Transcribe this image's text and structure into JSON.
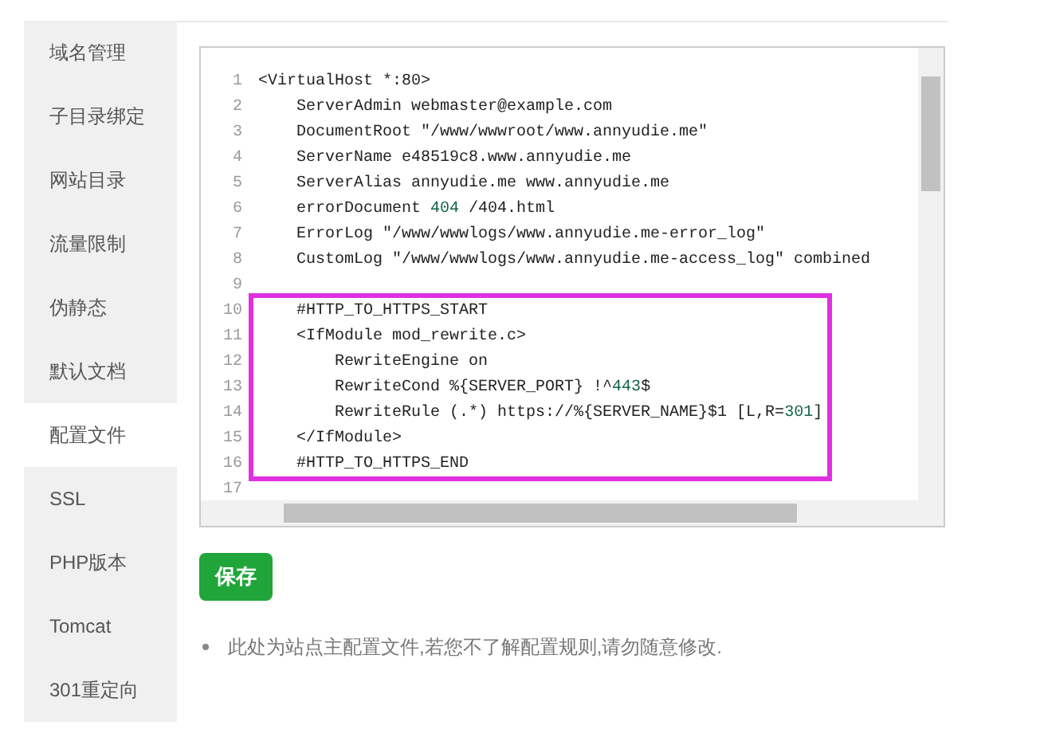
{
  "sidebar": {
    "items": [
      {
        "label": "域名管理",
        "selected": false
      },
      {
        "label": "子目录绑定",
        "selected": false
      },
      {
        "label": "网站目录",
        "selected": false
      },
      {
        "label": "流量限制",
        "selected": false
      },
      {
        "label": "伪静态",
        "selected": false
      },
      {
        "label": "默认文档",
        "selected": false
      },
      {
        "label": "配置文件",
        "selected": true
      },
      {
        "label": "SSL",
        "selected": false
      },
      {
        "label": "PHP版本",
        "selected": false
      },
      {
        "label": "Tomcat",
        "selected": false
      },
      {
        "label": "301重定向",
        "selected": false
      }
    ]
  },
  "editor": {
    "blocks": [
      {
        "highlighted": false,
        "lines": [
          {
            "number": "1",
            "tokens": [
              {
                "text": "<VirtualHost *:80>",
                "kind": "plain"
              }
            ]
          },
          {
            "number": "2",
            "tokens": [
              {
                "text": "    ServerAdmin webmaster@example.com",
                "kind": "plain"
              }
            ]
          },
          {
            "number": "3",
            "tokens": [
              {
                "text": "    DocumentRoot \"/www/wwwroot/www.annyudie.me\"",
                "kind": "plain"
              }
            ]
          },
          {
            "number": "4",
            "tokens": [
              {
                "text": "    ServerName e48519c8.www.annyudie.me",
                "kind": "plain"
              }
            ]
          },
          {
            "number": "5",
            "tokens": [
              {
                "text": "    ServerAlias annyudie.me www.annyudie.me",
                "kind": "plain"
              }
            ]
          },
          {
            "number": "6",
            "tokens": [
              {
                "text": "    errorDocument ",
                "kind": "plain"
              },
              {
                "text": "404",
                "kind": "number"
              },
              {
                "text": " /404.html",
                "kind": "plain"
              }
            ]
          },
          {
            "number": "7",
            "tokens": [
              {
                "text": "    ErrorLog \"/www/wwwlogs/www.annyudie.me-error_log\"",
                "kind": "plain"
              }
            ]
          },
          {
            "number": "8",
            "tokens": [
              {
                "text": "    CustomLog \"/www/wwwlogs/www.annyudie.me-access_log\" combined",
                "kind": "plain"
              }
            ]
          },
          {
            "number": "9"
          }
        ]
      },
      {
        "highlighted": true,
        "lines": [
          {
            "number": "10",
            "tokens": [
              {
                "text": "    #HTTP_TO_HTTPS_START",
                "kind": "plain"
              }
            ]
          },
          {
            "number": "11",
            "tokens": [
              {
                "text": "    <IfModule mod_rewrite.c>",
                "kind": "plain"
              }
            ]
          },
          {
            "number": "12",
            "tokens": [
              {
                "text": "        RewriteEngine on",
                "kind": "plain"
              }
            ]
          },
          {
            "number": "13",
            "tokens": [
              {
                "text": "        RewriteCond %{SERVER_PORT} !^",
                "kind": "plain"
              },
              {
                "text": "443",
                "kind": "number"
              },
              {
                "text": "$",
                "kind": "plain"
              }
            ]
          },
          {
            "number": "14",
            "tokens": [
              {
                "text": "        RewriteRule (.*) https://%{SERVER_NAME}$1 [L,R=",
                "kind": "plain"
              },
              {
                "text": "301",
                "kind": "number"
              },
              {
                "text": "]",
                "kind": "plain"
              }
            ]
          },
          {
            "number": "15",
            "tokens": [
              {
                "text": "    </IfModule>",
                "kind": "plain"
              }
            ]
          },
          {
            "number": "16",
            "tokens": [
              {
                "text": "    #HTTP_TO_HTTPS_END",
                "kind": "plain"
              }
            ]
          }
        ]
      },
      {
        "highlighted": false,
        "lines": [
          {
            "number": "17"
          }
        ]
      }
    ]
  },
  "save_button": "保存",
  "notes": [
    "此处为站点主配置文件,若您不了解配置规则,请勿随意修改."
  ]
}
